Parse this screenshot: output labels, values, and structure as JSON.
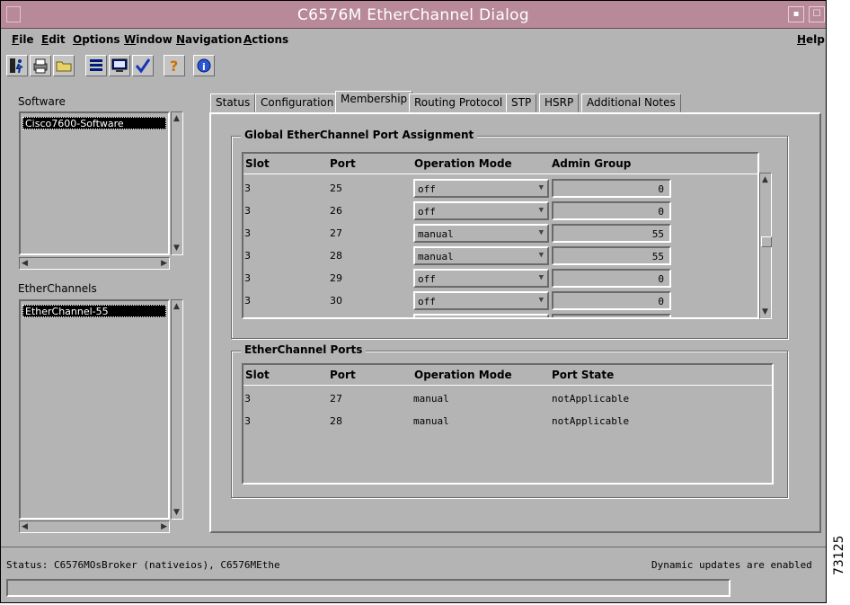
{
  "window": {
    "title": "C6576M EtherChannel Dialog"
  },
  "menubar": {
    "items": [
      {
        "first": "F",
        "rest": "ile"
      },
      {
        "first": "E",
        "rest": "dit"
      },
      {
        "first": "O",
        "rest": "ptions"
      },
      {
        "first": "W",
        "rest": "indow"
      },
      {
        "first": "N",
        "rest": "avigation"
      },
      {
        "first": "A",
        "rest": "ctions"
      }
    ],
    "help": {
      "first": "H",
      "rest": "elp"
    }
  },
  "toolbar": {
    "icons": [
      "exit-icon",
      "print-icon",
      "open-folder-icon",
      "list-icon",
      "monitor-icon",
      "check-icon",
      "help-icon",
      "info-icon"
    ]
  },
  "sidebar": {
    "software_label": "Software",
    "software_items": [
      "Cisco7600-Software"
    ],
    "etherchannels_label": "EtherChannels",
    "etherchannel_items": [
      "EtherChannel-55"
    ]
  },
  "tabs": [
    {
      "label": "Status",
      "active": false
    },
    {
      "label": "Configuration",
      "active": false
    },
    {
      "label": "Membership",
      "active": true
    },
    {
      "label": "Routing Protocol",
      "active": false
    },
    {
      "label": "STP",
      "active": false
    },
    {
      "label": "HSRP",
      "active": false
    },
    {
      "label": "Additional Notes",
      "active": false
    }
  ],
  "global_assignment": {
    "title": "Global EtherChannel Port Assignment",
    "headers": {
      "slot": "Slot",
      "port": "Port",
      "mode": "Operation Mode",
      "group": "Admin Group"
    },
    "rows": [
      {
        "slot": "3",
        "port": "25",
        "mode": "off",
        "group": "0"
      },
      {
        "slot": "3",
        "port": "26",
        "mode": "off",
        "group": "0"
      },
      {
        "slot": "3",
        "port": "27",
        "mode": "manual",
        "group": "55"
      },
      {
        "slot": "3",
        "port": "28",
        "mode": "manual",
        "group": "55"
      },
      {
        "slot": "3",
        "port": "29",
        "mode": "off",
        "group": "0"
      },
      {
        "slot": "3",
        "port": "30",
        "mode": "off",
        "group": "0"
      }
    ]
  },
  "etherchannel_ports": {
    "title": "EtherChannel Ports",
    "headers": {
      "slot": "Slot",
      "port": "Port",
      "mode": "Operation Mode",
      "state": "Port State"
    },
    "rows": [
      {
        "slot": "3",
        "port": "27",
        "mode": "manual",
        "state": "notApplicable"
      },
      {
        "slot": "3",
        "port": "28",
        "mode": "manual",
        "state": "notApplicable"
      }
    ]
  },
  "status": {
    "left": "Status: C6576MOsBroker (nativeios), C6576MEthe",
    "right": "Dynamic updates are enabled"
  },
  "figure_id": "73125"
}
